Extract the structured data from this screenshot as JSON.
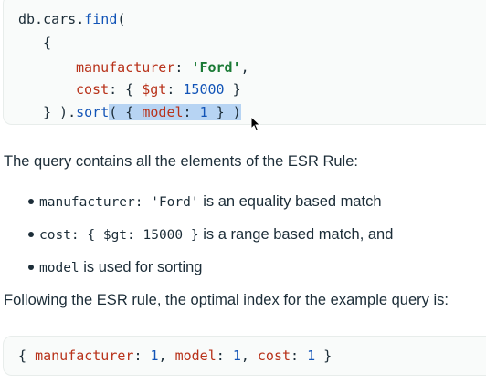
{
  "query_code": {
    "line1_prefix": "db.cars.",
    "line1_fn": "find",
    "line1_suffix": "(",
    "line2": "{",
    "line3_key": "manufacturer",
    "line3_colon": ": ",
    "line3_value": "'Ford'",
    "line3_end": ",",
    "line4_key": "cost",
    "line4_mid": ": { ",
    "line4_op": "$gt",
    "line4_colon": ": ",
    "line4_value": "15000",
    "line4_end": " }",
    "line5_prefix": "} ).",
    "line5_fn": "sort",
    "line5_sel_open": "( { ",
    "line5_key": "model",
    "line5_colon": ": ",
    "line5_value": "1",
    "line5_sel_close": " } )"
  },
  "intro_text": "The query contains all the elements of the ESR Rule:",
  "bullets": [
    {
      "code": "manufacturer: 'Ford'",
      "text": " is an equality based match"
    },
    {
      "code": "cost: { $gt: 15000 }",
      "text": " is a range based match, and"
    },
    {
      "code": "model",
      "text": " is used for sorting"
    }
  ],
  "conclusion_text": "Following the ESR rule, the optimal index for the example query is:",
  "index_code": {
    "open": "{ ",
    "k1": "manufacturer",
    "c1": ": ",
    "v1": "1",
    "sep1": ", ",
    "k2": "model",
    "c2": ": ",
    "v2": "1",
    "sep2": ", ",
    "k3": "cost",
    "c3": ": ",
    "v3": "1",
    "close": " }"
  },
  "colors": {
    "text": "#1c2d38",
    "code_bg": "#f9fbfa",
    "keyword_blue": "#1254b7",
    "key_red": "#b8321a",
    "string_green": "#1a7a35",
    "selection": "#b7d4f3"
  },
  "icons": {
    "cursor": "mouse-pointer-icon"
  }
}
